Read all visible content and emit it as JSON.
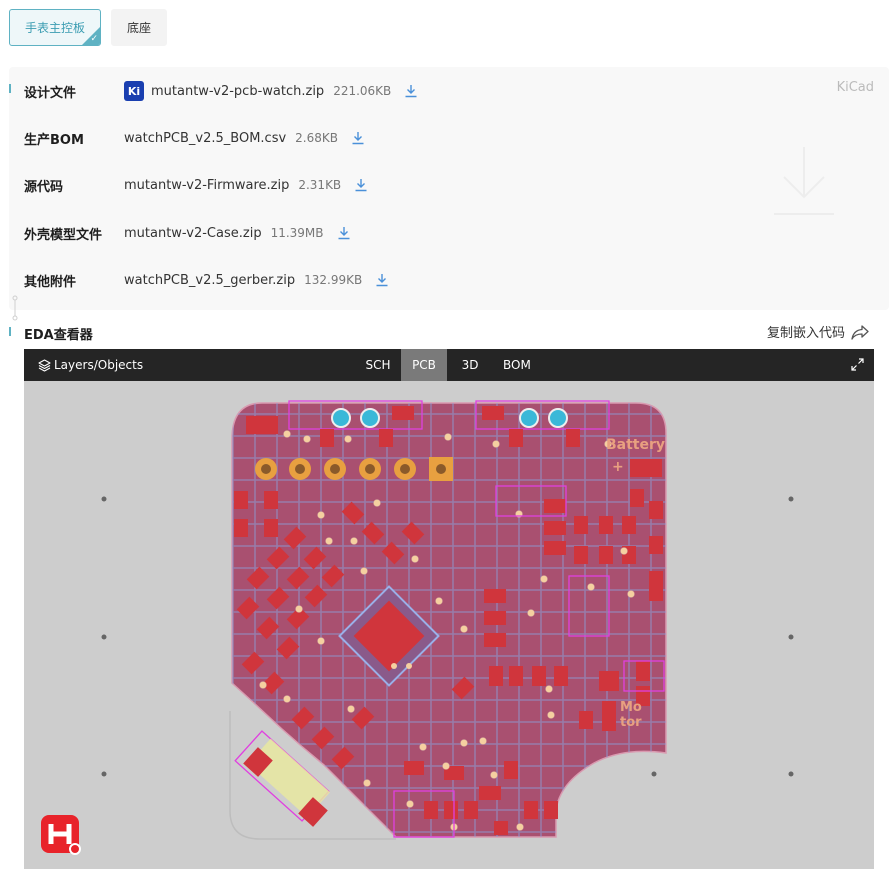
{
  "tabs": [
    {
      "label": "手表主控板",
      "active": true
    },
    {
      "label": "底座",
      "active": false
    }
  ],
  "files": {
    "badge": "KiCad",
    "rows": [
      {
        "label": "设计文件",
        "icon": "kicad-icon",
        "icon_text": "Ki",
        "name": "mutantw-v2-pcb-watch.zip",
        "size": "221.06KB"
      },
      {
        "label": "生产BOM",
        "name": "watchPCB_v2.5_BOM.csv",
        "size": "2.68KB"
      },
      {
        "label": "源代码",
        "name": "mutantw-v2-Firmware.zip",
        "size": "2.31KB"
      },
      {
        "label": "外壳模型文件",
        "name": "mutantw-v2-Case.zip",
        "size": "11.39MB"
      },
      {
        "label": "其他附件",
        "name": "watchPCB_v2.5_gerber.zip",
        "size": "132.99KB"
      }
    ]
  },
  "eda": {
    "title": "EDA查看器",
    "embed_label": "复制嵌入代码",
    "layers_label": "Layers/Objects",
    "view_tabs": [
      {
        "label": "SCH",
        "active": false
      },
      {
        "label": "PCB",
        "active": true
      },
      {
        "label": "3D",
        "active": false
      },
      {
        "label": "BOM",
        "active": false
      }
    ],
    "silkscreen_texts": [
      "Battery",
      "+",
      "Mo",
      "tor"
    ]
  },
  "colors": {
    "accent": "#5fb2c3",
    "download": "#4a90d9",
    "toolbar": "#252525",
    "pcb_copper": "#c8323a",
    "pcb_board": "#a95070"
  }
}
